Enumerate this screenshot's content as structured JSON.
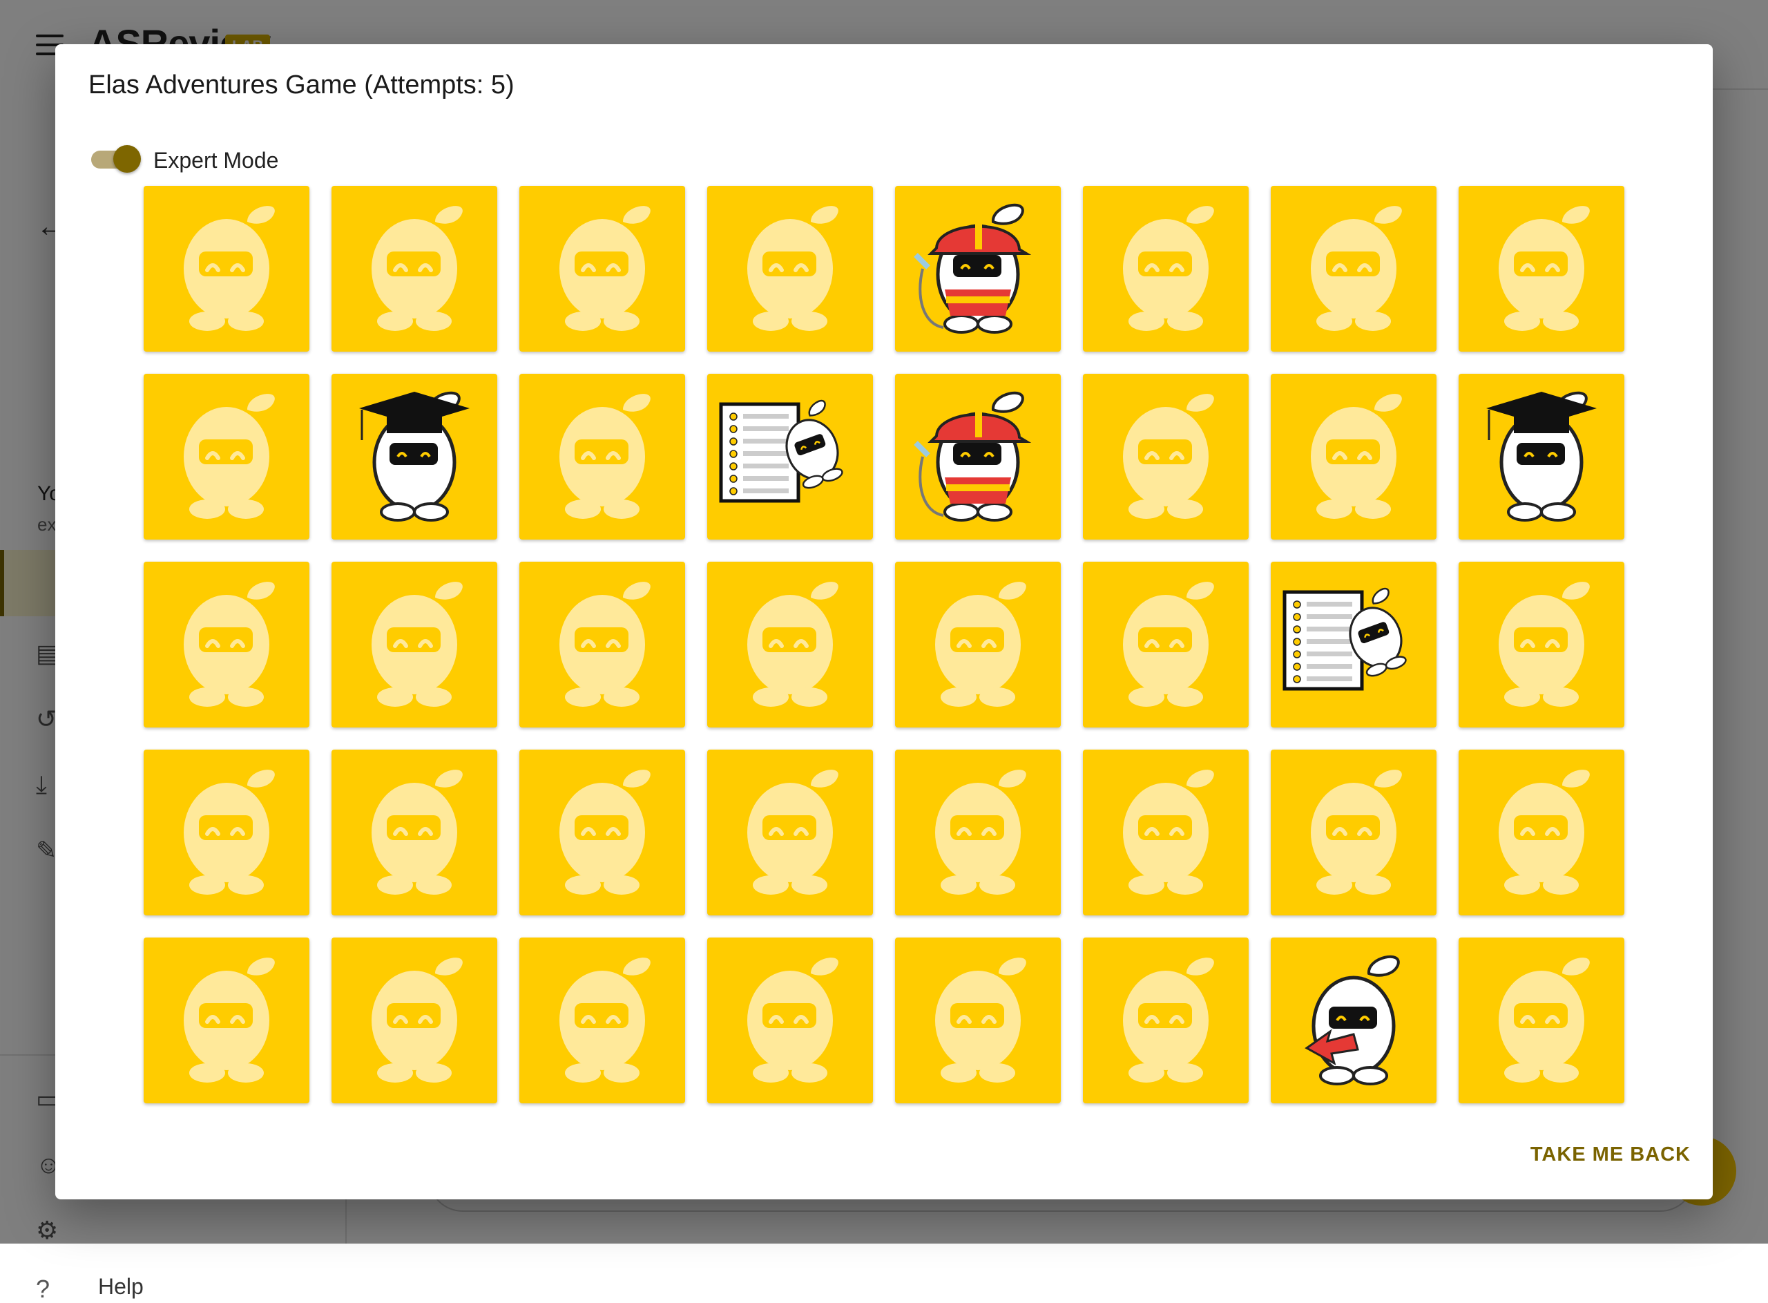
{
  "background": {
    "logo": "ASReview",
    "logo_badge": "LAB",
    "sidebar_title": "Yo",
    "sidebar_subtitle": "ex",
    "help_label": "Help"
  },
  "dialog": {
    "title": "Elas Adventures Game (Attempts: 5)",
    "expert_mode_label": "Expert Mode",
    "expert_mode_on": true,
    "action_label": "TAKE ME BACK"
  },
  "colors": {
    "card_background": "#ffcc00",
    "card_back_figure": "#ffe99a",
    "action_text": "#7a6300",
    "toggle_thumb": "#7e6600"
  },
  "cards": [
    [
      "hidden",
      "hidden",
      "hidden",
      "hidden",
      "firefighter",
      "hidden",
      "hidden",
      "hidden"
    ],
    [
      "hidden",
      "graduate",
      "hidden",
      "checklist",
      "firefighter",
      "hidden",
      "hidden",
      "graduate"
    ],
    [
      "hidden",
      "hidden",
      "hidden",
      "hidden",
      "hidden",
      "hidden",
      "checklist",
      "hidden"
    ],
    [
      "hidden",
      "hidden",
      "hidden",
      "hidden",
      "hidden",
      "hidden",
      "hidden",
      "hidden"
    ],
    [
      "hidden",
      "hidden",
      "hidden",
      "hidden",
      "hidden",
      "hidden",
      "arrow",
      "hidden"
    ]
  ]
}
